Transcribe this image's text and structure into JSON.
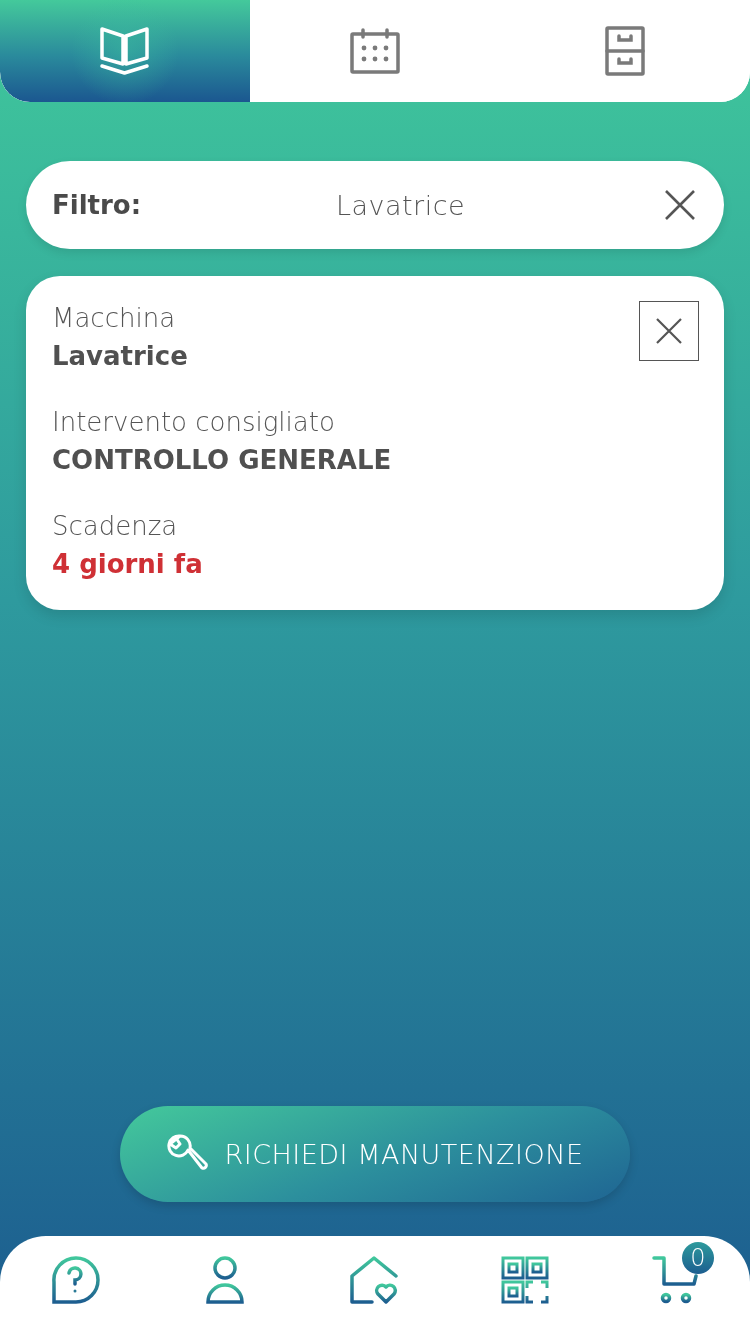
{
  "top_tabs": [
    {
      "kind": "book",
      "selected": true
    },
    {
      "kind": "calendar",
      "selected": false
    },
    {
      "kind": "cabinet",
      "selected": false
    }
  ],
  "filter": {
    "label": "Filtro:",
    "value": "Lavatrice"
  },
  "card": {
    "fields": [
      {
        "label": "Macchina",
        "value": "Lavatrice",
        "kind": "normal"
      },
      {
        "label": "Intervento consigliato",
        "value": "CONTROLLO GENERALE",
        "kind": "normal"
      },
      {
        "label": "Scadenza",
        "value": "4 giorni fa",
        "kind": "overdue"
      }
    ]
  },
  "action_button": {
    "label": "RICHIEDI MANUTENZIONE"
  },
  "bottom_nav": [
    {
      "kind": "help"
    },
    {
      "kind": "user"
    },
    {
      "kind": "home"
    },
    {
      "kind": "qr"
    },
    {
      "kind": "cart",
      "badge": "0"
    }
  ]
}
